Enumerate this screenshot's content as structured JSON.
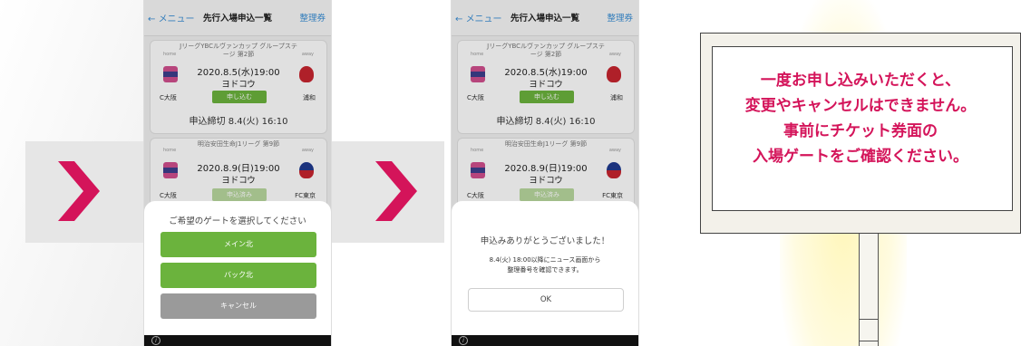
{
  "colors": {
    "accent_pink": "#d4145a",
    "green": "#6bb33d",
    "link_blue": "#3a8fd6"
  },
  "nav": {
    "back": "メニュー",
    "title": "先行入場申込一覧",
    "right": "整理券"
  },
  "labels": {
    "home": "home",
    "away": "away"
  },
  "matches": [
    {
      "competition": "JリーグYBCルヴァンカップ グループステージ 第2節",
      "datetime": "2020.8.5(水)19:00",
      "venue": "ヨドコウ",
      "home_team": "C大阪",
      "away_team": "浦和",
      "apply_label": "申し込む",
      "home_logo": "cerezo-emblem-icon",
      "away_logo": "urawa-emblem-icon"
    },
    {
      "competition": "明治安田生命J1リーグ 第9節",
      "datetime": "2020.8.9(日)19:00",
      "venue": "ヨドコウ",
      "home_team": "C大阪",
      "away_team": "FC東京",
      "apply_label": "申込済み",
      "home_logo": "cerezo-emblem-icon",
      "away_logo": "fc-tokyo-emblem-icon"
    }
  ],
  "deadline": "申込締切 8.4(火) 16:10",
  "gate_modal": {
    "title": "ご希望のゲートを選択してください",
    "options": [
      "メイン北",
      "バック北"
    ],
    "cancel": "キャンセル"
  },
  "confirm_modal": {
    "title": "申込みありがとうございました！",
    "message_line1": "8.4(火) 18:00以降にニュース画面から",
    "message_line2": "整理番号を確認できます。",
    "ok": "OK"
  },
  "step_arrow_icon": "chevron-right-icon",
  "sign": {
    "line1": "一度お申し込みいただくと、",
    "line2": "変更やキャンセルはできません。",
    "line3": "事前にチケット券面の",
    "line4": "入場ゲートをご確認ください。"
  }
}
